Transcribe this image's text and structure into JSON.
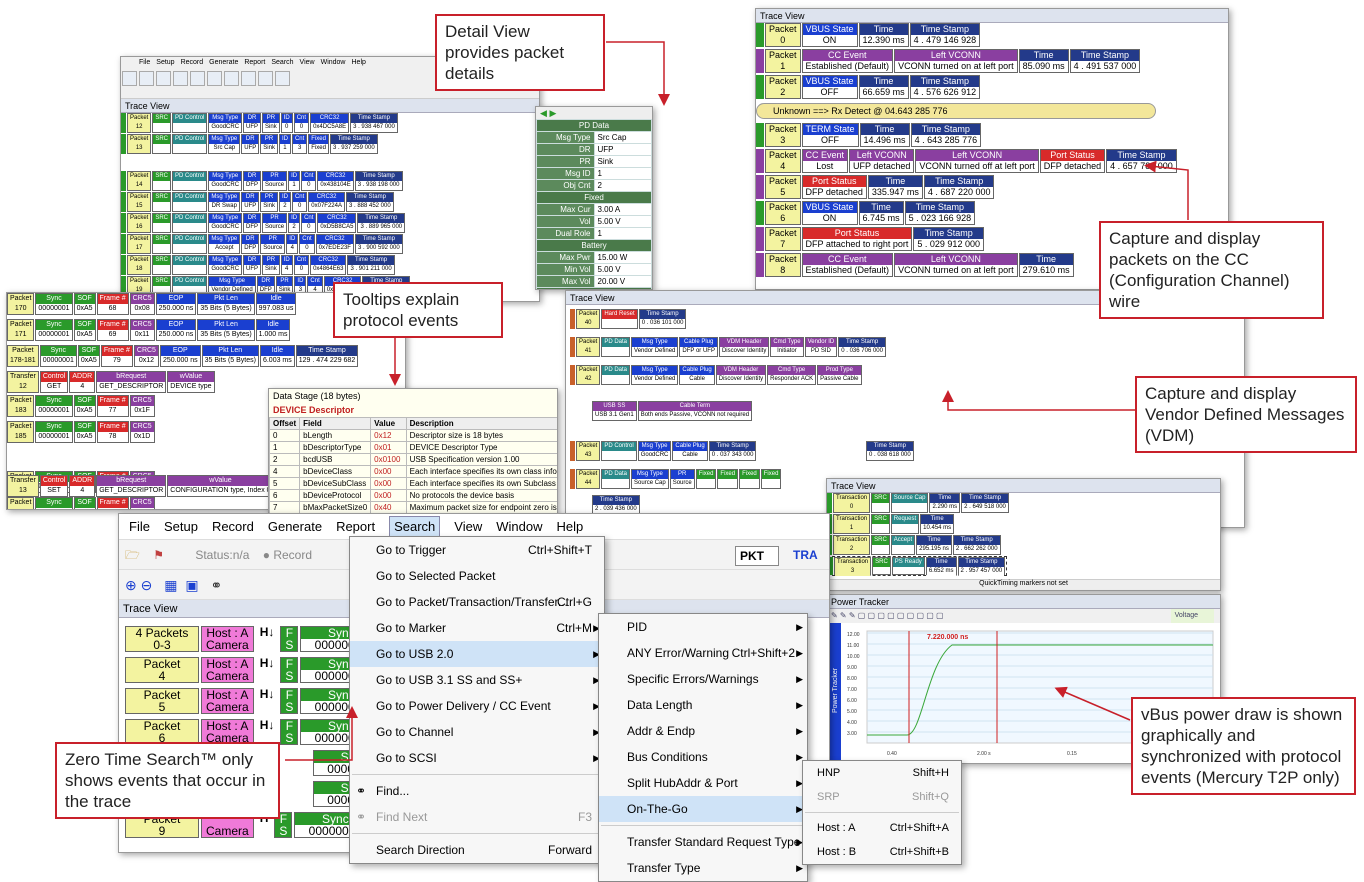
{
  "callouts": {
    "detail": "Detail View provides packet details",
    "tooltips": "Tooltips explain protocol events",
    "capture_cc": "Capture and display packets on the CC (Configuration Channel) wire",
    "capture_vdm": "Capture and display Vendor Defined Messages (VDM)",
    "zero_time": "Zero Time Search™ only shows events that occur in the trace",
    "vbus": "vBus power draw is shown graphically and synchronized with protocol events (Mercury T2P only)"
  },
  "main_menu": [
    "File",
    "Setup",
    "Record",
    "Generate",
    "Report",
    "Search",
    "View",
    "Window",
    "Help"
  ],
  "toolbar": {
    "status": "Status:n/a",
    "record": "Record",
    "pkt": "PKT",
    "tra": "TRA"
  },
  "trace_view_title": "Trace View",
  "search_menu": [
    {
      "label": "Go to Trigger",
      "shortcut": "Ctrl+Shift+T"
    },
    {
      "label": "Go to Selected Packet",
      "shortcut": ""
    },
    {
      "label": "Go to Packet/Transaction/Transfer...",
      "shortcut": "Ctrl+G"
    },
    {
      "label": "Go to Marker",
      "shortcut": "Ctrl+M"
    },
    {
      "label": "Go to USB 2.0",
      "shortcut": ""
    },
    {
      "label": "Go to USB 3.1 SS and SS+",
      "shortcut": ""
    },
    {
      "label": "Go to Power Delivery / CC Event",
      "shortcut": ""
    },
    {
      "label": "Go to Channel",
      "shortcut": ""
    },
    {
      "label": "Go to SCSI",
      "shortcut": ""
    },
    {
      "label": "Find...",
      "shortcut": ""
    },
    {
      "label": "Find Next",
      "shortcut": "F3"
    },
    {
      "label": "Search Direction",
      "shortcut": "Forward"
    }
  ],
  "usb2_menu": [
    {
      "label": "PID"
    },
    {
      "label": "ANY Error/Warning",
      "shortcut": "Ctrl+Shift+2"
    },
    {
      "label": "Specific Errors/Warnings"
    },
    {
      "label": "Data Length"
    },
    {
      "label": "Addr & Endp"
    },
    {
      "label": "Bus Conditions"
    },
    {
      "label": "Split HubAddr & Port"
    },
    {
      "label": "On-The-Go"
    },
    {
      "label": "Transfer Standard Request Type"
    },
    {
      "label": "Transfer Type"
    }
  ],
  "otg_menu": [
    {
      "label": "HNP",
      "shortcut": "Shift+H"
    },
    {
      "label": "SRP",
      "shortcut": "Shift+Q"
    },
    {
      "label": "Host : A",
      "shortcut": "Ctrl+Shift+A"
    },
    {
      "label": "Host : B",
      "shortcut": "Ctrl+Shift+B"
    }
  ],
  "bottom_rows": [
    {
      "pkt_h": "4 Packets",
      "pkt_v": "0-3",
      "host_h": "Host : A",
      "host_v": "Camera",
      "sync": "00000001"
    },
    {
      "pkt_h": "Packet",
      "pkt_v": "4",
      "host_h": "Host : A",
      "host_v": "Camera",
      "sync": "00000001"
    },
    {
      "pkt_h": "Packet",
      "pkt_v": "5",
      "host_h": "Host : A",
      "host_v": "Camera",
      "sync": "00000001"
    },
    {
      "pkt_h": "Packet",
      "pkt_v": "6",
      "host_h": "Host : A",
      "host_v": "Camera",
      "sync": "00000001"
    }
  ],
  "bottom_last": {
    "pkt_h": "Packet",
    "pkt_v": "9",
    "host_v": "Camera",
    "sync": "00000001",
    "data1": "DATA 1",
    "pid": "0xD2",
    "bytes": "18 bytes",
    "crc": "0xE8FA",
    "eop": "250.000 ns",
    "len": "179 Bits (23 Bytes)",
    "idle": "565.330 ns",
    "ts": "1.517 191 300"
  },
  "bottom_row8": {
    "sync": "00000001",
    "pid": "0x96",
    "a": "0",
    "b": "0",
    "c": "0x08",
    "eop": "250.000 ns",
    "len": "35 Bits (5"
  },
  "cc_trace": [
    {
      "num": "0",
      "type": "VBUS State",
      "val": "ON",
      "time": "12.390 ms",
      "ts": "4 . 479 146 928"
    },
    {
      "num": "1",
      "type": "CC Event",
      "val": "Established (Default)",
      "extra": "VCONN turned on at left port",
      "time": "85.090 ms",
      "ts": "4 . 491 537 000"
    },
    {
      "num": "2",
      "type": "VBUS State",
      "val": "OFF",
      "time": "66.659 ms",
      "ts": "4 . 576 626 912"
    },
    {
      "num": "3",
      "type": "TERM State",
      "val": "OFF",
      "time": "14.496 ms",
      "ts": "4 . 643 285 776"
    },
    {
      "num": "4",
      "type": "CC Event",
      "val": "Lost",
      "extra": "UFP detached",
      "extra2": "VCONN turned off at left port",
      "extra3": "DFP detached",
      "ts": "4 . 657 782 000"
    },
    {
      "num": "5",
      "type": "Port Status",
      "val": "DFP detached",
      "time": "335.947 ms",
      "ts": "4 . 687 220 000"
    },
    {
      "num": "6",
      "type": "VBUS State",
      "val": "ON",
      "time": "6.745 ms",
      "ts": "5 . 023 166 928"
    },
    {
      "num": "7",
      "type": "Port Status",
      "val": "DFP attached to right port",
      "ts": "5 . 029 912 000"
    },
    {
      "num": "8",
      "type": "CC Event",
      "val": "Established (Default)",
      "extra": "VCONN turned on at left port",
      "time": "279.610 ms"
    }
  ],
  "cc_unknown": "Unknown ==> Rx Detect @ 04.643 285 776",
  "tooltip": {
    "title": "Data Stage (18 bytes)",
    "header": "DEVICE Descriptor",
    "cols": [
      "Offset",
      "Field",
      "Value",
      "Description"
    ],
    "rows": [
      [
        "0",
        "bLength",
        "0x12",
        "Descriptor size is 18 bytes"
      ],
      [
        "1",
        "bDescriptorType",
        "0x01",
        "DEVICE Descriptor Type"
      ],
      [
        "2",
        "bcdUSB",
        "0x0100",
        "USB Specification version 1.00"
      ],
      [
        "4",
        "bDeviceClass",
        "0x00",
        "Each interface specifies its own class information"
      ],
      [
        "5",
        "bDeviceSubClass",
        "0x00",
        "Each interface specifies its own Subclass information"
      ],
      [
        "6",
        "bDeviceProtocol",
        "0x00",
        "No protocols the device basis"
      ],
      [
        "7",
        "bMaxPacketSize0",
        "0x40",
        "Maximum packet size for endpoint zero is 64"
      ],
      [
        "8",
        "idVendor",
        "0x08EC",
        "Vendor ID is 2284: M-Systems Flash Disk Pioneers"
      ],
      [
        "10",
        "idProduct",
        "0x0010",
        "Product ID is 16"
      ]
    ]
  },
  "detail_view": [
    {
      "sec": "PD Data"
    },
    {
      "k": "Msg Type",
      "v": "Src Cap"
    },
    {
      "k": "DR",
      "v": "UFP"
    },
    {
      "k": "PR",
      "v": "Sink"
    },
    {
      "k": "Msg ID",
      "v": "1"
    },
    {
      "k": "Obj Cnt",
      "v": "2"
    },
    {
      "sec": "Fixed"
    },
    {
      "k": "Max Cur",
      "v": "3.00 A"
    },
    {
      "k": "Vol",
      "v": "5.00 V"
    },
    {
      "k": "Dual Role",
      "v": "1"
    },
    {
      "sec": "Battery"
    },
    {
      "k": "Max Pwr",
      "v": "15.00 W"
    },
    {
      "k": "Min Vol",
      "v": "5.00 V"
    },
    {
      "k": "Max Vol",
      "v": "20.00 V"
    },
    {
      "sec": "Variable"
    },
    {
      "k": "Max Cur",
      "v": "3.00 A"
    },
    {
      "k": "Min Vol",
      "v": "5.00 V"
    },
    {
      "k": "Max Vol",
      "v": "20.00 V"
    },
    {
      "k": "CRC32",
      "v": "0x4D0FE4D"
    }
  ],
  "power_tracker": {
    "title": "Power Tracker",
    "marker": "QuickTiming markers not set",
    "measure": "7.220.000 ns",
    "axis": "Power Tracker",
    "voltage_label": "Voltage",
    "yticks": [
      "12.00",
      "11.00",
      "10.00",
      "9.00",
      "8.00",
      "7.00",
      "6.00",
      "5.00",
      "4.00",
      "3.00"
    ],
    "xticks": [
      "0.40",
      "2.00 s",
      "0.15",
      "0.35"
    ]
  },
  "transactions": [
    {
      "h": "Transaction",
      "v": "0",
      "type": "Source Cap",
      "t": "2.290 ms",
      "ts": "2 . 649 518 000"
    },
    {
      "h": "Transaction",
      "v": "1",
      "type": "Request",
      "t": "10.454 ms"
    },
    {
      "h": "Transaction",
      "v": "2",
      "type": "Accept",
      "t": "295.195 ns",
      "ts": "2 . 662 262 000"
    },
    {
      "h": "Transaction",
      "v": "3",
      "type": "PS Ready",
      "t": "6.652 ms",
      "ts": "2 . 957 457 000"
    }
  ],
  "vdm": {
    "title": "Trace View",
    "hard_reset": "Hard Reset",
    "ts0": "0 . 036 101 000",
    "vdm_header": "VDM Header",
    "discover": "Discover Identity",
    "initiator": "Initiator",
    "pd_sid": "PD SID",
    "ts1": "0 . 036 706 000",
    "ts2": "0 . 037 343 000",
    "ts3": "0 . 038 618 000",
    "ts4": "2 . 039 436 000",
    "cable": "Cable",
    "passive_cable": "Passive Cable",
    "fixed": "Fixed",
    "ps_ready": "PS Ready",
    "good_crc": "GoodCRC",
    "notes": "Both ends Passive, VCONN not required",
    "usb31": "USB 3.1 Gen1",
    "responder": "Responder ACK",
    "vendor_defined": "Vendor Defined",
    "dfp_ufp": "DFP or UFP",
    "source_cap": "Source Cap",
    "source": "Source",
    "nums": [
      "40",
      "41",
      "42",
      "43",
      "44",
      "45",
      "46"
    ]
  },
  "left_trace": [
    {
      "pkt": "170",
      "sync": "00000001",
      "pid": "0xA5",
      "frame": "68",
      "crc": "0x08",
      "eop": "250.000 ns",
      "len": "35 Bits (5 Bytes)",
      "idle": "997.083 us"
    },
    {
      "pkt": "171",
      "sync": "00000001",
      "pid": "0xA5",
      "frame": "69",
      "crc": "0x11",
      "eop": "250.000 ns",
      "len": "35 Bits (5 Bytes)",
      "idle": "1.000 ms"
    },
    {
      "pkt": "178-181",
      "sync": "00000001",
      "pid": "0xA5",
      "frame": "79",
      "crc": "0x12",
      "eop": "250.000 ns",
      "len": "35 Bits (5 Bytes)",
      "idle": "6.003 ms",
      "ts": "129 . 474 229 682"
    },
    {
      "pkt": "183",
      "sync": "00000001",
      "pid": "0xA5",
      "frame": "77",
      "crc": "0x1F"
    },
    {
      "pkt": "185",
      "sync": "00000001",
      "pid": "0xA5",
      "frame": "78",
      "crc": "0x1D"
    },
    {
      "pkt": "193",
      "sync": "00000001",
      "pid": "0xA5",
      "frame": "79",
      "crc": "0x02"
    },
    {
      "pkt": "194",
      "sync": "00000001",
      "pid": "0xA5",
      "frame": "80",
      "crc": "0x18"
    }
  ],
  "transfer_rows": [
    {
      "num": "12",
      "get": "GET",
      "val": "4",
      "desc": "GET_DESCRIPTOR",
      "sub": "DEVICE type"
    },
    {
      "num": "13",
      "get": "SET",
      "val": "4",
      "desc": "GET_DESCRIPTOR",
      "sub": "CONFIGURATION type, Index 0"
    }
  ],
  "pd_trace": [
    {
      "num": "12",
      "msg": "GoodCRC",
      "dr": "UFP",
      "pr": "Sink",
      "id": "0",
      "cnt": "0",
      "crc": "0x4DC5A8E",
      "ts": "3 . 938 467 000"
    },
    {
      "num": "13",
      "msg": "Src Cap",
      "dr": "UFP",
      "pr": "Sink",
      "id": "1",
      "cnt": "3",
      "fixed": "Fixed",
      "ts": "3 . 937 259 000"
    },
    {
      "num": "14",
      "msg": "GoodCRC",
      "dr": "DFP",
      "pr": "Source",
      "id": "1",
      "cnt": "0",
      "crc": "0x438104E",
      "ts": "3 . 938 198 000"
    },
    {
      "num": "15",
      "msg": "DR Swap",
      "dr": "UFP",
      "pr": "Sink",
      "id": "2",
      "cnt": "0",
      "crc": "0x07F224A",
      "ts": "3 . 888 452 000"
    },
    {
      "num": "16",
      "msg": "GoodCRC",
      "dr": "DFP",
      "pr": "Source",
      "id": "2",
      "cnt": "0",
      "crc": "0xD5B8CA5",
      "ts": "3 . 889 965 000"
    },
    {
      "num": "17",
      "msg": "Accept",
      "dr": "DFP",
      "pr": "Source",
      "id": "4",
      "cnt": "0",
      "crc": "0x7EDE23F",
      "ts": "3 . 900 592 000"
    },
    {
      "num": "18",
      "msg": "GoodCRC",
      "dr": "UFP",
      "pr": "Sink",
      "id": "4",
      "cnt": "0",
      "crc": "0x4864E63",
      "ts": "3 . 901 211 000"
    },
    {
      "num": "19",
      "msg": "Vendor Defined",
      "dr": "DFP",
      "pr": "Sink",
      "id": "3",
      "cnt": "4",
      "crc": "0x4F6BD39",
      "ts": "3 . 901 846 000"
    }
  ]
}
